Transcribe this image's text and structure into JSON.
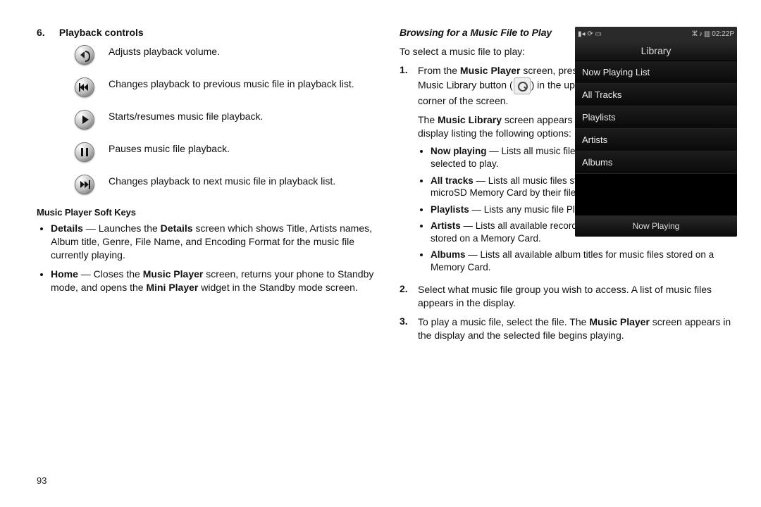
{
  "page_number": "93",
  "left": {
    "section_number": "6.",
    "section_title": "Playback controls",
    "controls": [
      {
        "icon": "volume-icon",
        "desc": "Adjusts playback volume."
      },
      {
        "icon": "previous-icon",
        "desc": "Changes playback to previous music file in playback list."
      },
      {
        "icon": "play-icon",
        "desc": "Starts/resumes music file playback."
      },
      {
        "icon": "pause-icon",
        "desc": "Pauses music file playback."
      },
      {
        "icon": "next-icon",
        "desc": "Changes playback to next music file in playback list."
      }
    ],
    "softkeys_heading": "Music Player Soft Keys",
    "softkeys": [
      {
        "term": "Details",
        "sep": " — Launches the ",
        "bold2": "Details",
        "rest": " screen which shows Title, Artists names, Album title, Genre, File Name, and Encoding Format for the music file currently playing."
      },
      {
        "term": "Home",
        "sep": " — Closes the ",
        "bold2": "Music Player",
        "mid": " screen, returns your phone to Standby mode, and opens the ",
        "bold3": "Mini Player",
        "rest": " widget in the Standby mode screen."
      }
    ]
  },
  "right": {
    "heading": "Browsing for a Music File to Play",
    "intro": "To select a music file to play:",
    "steps": [
      {
        "num": "1.",
        "pre": "From the ",
        "b1": "Music Player",
        "mid1": " screen, press the Music Library button (",
        "mid2": ") in the upper left corner of the screen.",
        "para2_pre": "The ",
        "para2_b": "Music Library",
        "para2_post": " screen appears in the display listing the following options:",
        "opts": [
          {
            "term": "Now playing",
            "rest": " — Lists all music files you have selected to play."
          },
          {
            "term": "All tracks",
            "rest": " — Lists all music files stored in the My Music folder on a microSD Memory Card by their file names."
          },
          {
            "term": "Playlists",
            "rest": " — Lists any music file Playlist(s) you have created."
          },
          {
            "term": "Artists",
            "rest": " — Lists all available recording artists names with music files stored on a Memory Card."
          },
          {
            "term": "Albums",
            "rest": " — Lists all available album titles for music files stored on a Memory Card."
          }
        ]
      },
      {
        "num": "2.",
        "text": "Select what music file group you wish to access. A list of music files appears in the display."
      },
      {
        "num": "3.",
        "pre": "To play a music file, select the file. The ",
        "b1": "Music Player",
        "post": " screen appears in the display and the selected file begins playing."
      }
    ],
    "phone": {
      "time": "02:22P",
      "title": "Library",
      "items": [
        "Now Playing List",
        "All Tracks",
        "Playlists",
        "Artists",
        "Albums"
      ],
      "footer": "Now Playing"
    }
  }
}
